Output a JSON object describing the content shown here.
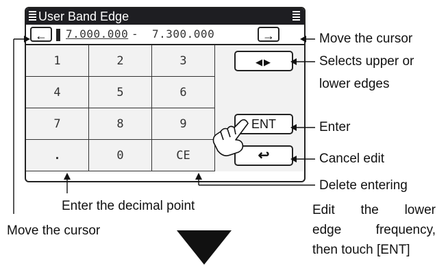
{
  "window": {
    "title": "User Band Edge"
  },
  "frequency": {
    "lower": "7.000.000",
    "separator": "-",
    "upper": "7.300.000"
  },
  "buttons": {
    "cursor_left": "←",
    "cursor_right": "→",
    "edge_select": "◀▶",
    "enter": "ENT",
    "cancel": "↩"
  },
  "keypad": [
    [
      "1",
      "2",
      "3"
    ],
    [
      "4",
      "5",
      "6"
    ],
    [
      "7",
      "8",
      "9"
    ],
    [
      ".",
      "0",
      "CE"
    ]
  ],
  "annotations": {
    "move_cursor_right": "Move the cursor",
    "selects_edges_1": "Selects upper or",
    "selects_edges_2": "lower edges",
    "enter": "Enter",
    "cancel_edit": "Cancel edit",
    "delete_entering": "Delete entering",
    "decimal_point": "Enter the decimal point",
    "move_cursor_left": "Move the cursor",
    "instruction_lines": [
      "Edit the lower",
      "edge frequency,",
      "then touch [ENT]"
    ]
  },
  "colors": {
    "titlebar": "#1e1e22",
    "key_bg": "#f2f2f2",
    "outline": "#222222"
  },
  "icons": {
    "menu": "menu-lines-icon",
    "hand": "pointing-hand-icon",
    "down": "down-triangle-icon"
  }
}
